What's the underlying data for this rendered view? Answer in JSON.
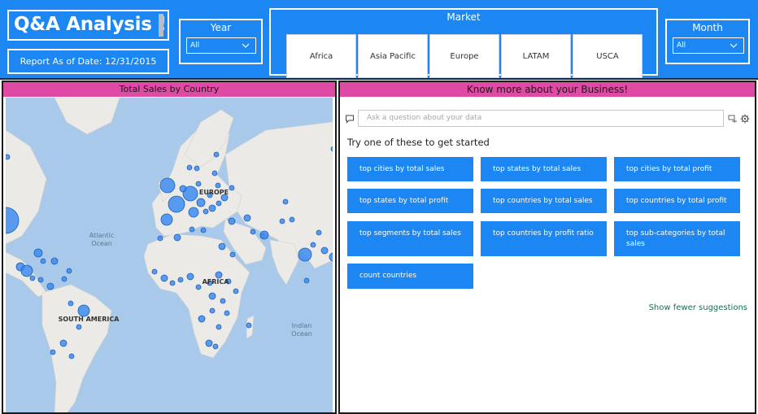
{
  "header": {
    "title": "Q&A Analysis !",
    "report_date": "Report As of Date: 12/31/2015"
  },
  "year_slicer": {
    "title": "Year",
    "value": "All"
  },
  "market_slicer": {
    "title": "Market",
    "options": [
      "Africa",
      "Asia Pacific",
      "Europe",
      "LATAM",
      "USCA"
    ]
  },
  "month_slicer": {
    "title": "Month",
    "value": "All"
  },
  "map_panel": {
    "title": "Total Sales by Country",
    "labels": {
      "europe": "EUROPE",
      "africa": "AFRICA",
      "south_america": "SOUTH AMERICA",
      "atlantic_1": "Atlantic",
      "atlantic_2": "Ocean",
      "indian_1": "Indian",
      "indian_2": "Ocean"
    }
  },
  "qa_panel": {
    "title": "Know more about your Business!",
    "input_placeholder": "Ask a question about your data",
    "try_text": "Try one of these to get started",
    "suggestions": [
      "top cities by total sales",
      "top states by total sales",
      "top cities by total profit",
      "top states by total profit",
      "top countries by total sales",
      "top countries by total profit",
      "top segments by total sales",
      "top countries by profit ratio",
      "top sub-categories by total sales",
      "count countries"
    ],
    "show_fewer": "Show fewer suggestions"
  },
  "colors": {
    "header_blue": "#1c87f3",
    "panel_header_pink": "#de4aa4",
    "map_water": "#a9c9ea",
    "map_land": "#eceae6",
    "bubble_fill": "#3d8cf0",
    "show_fewer_green": "#1e6b52"
  },
  "icons": [
    "chevron-down-icon",
    "chat-icon",
    "teach-icon",
    "settings-gear-icon"
  ]
}
